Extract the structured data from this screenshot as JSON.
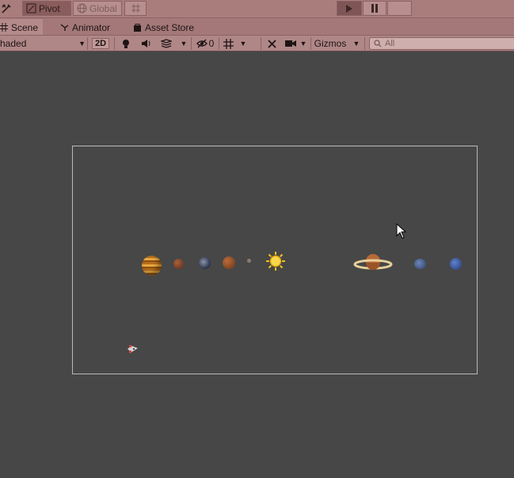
{
  "toolbar": {
    "pivot_label": "Pivot",
    "global_label": "Global"
  },
  "tabs": [
    {
      "label": "Scene",
      "icon": "grid-icon",
      "active": true
    },
    {
      "label": "Animator",
      "icon": "animator-icon",
      "active": false
    },
    {
      "label": "Asset Store",
      "icon": "bag-icon",
      "active": false
    }
  ],
  "scene_toolbar": {
    "shading_mode": "haded",
    "mode_2d_label": "2D",
    "hidden_count": "0",
    "gizmos_label": "Gizmos",
    "search_value": "All"
  },
  "scene": {
    "objects": [
      {
        "name": "jupiter",
        "icon": "planet-jupiter"
      },
      {
        "name": "mars-small",
        "icon": "planet-mars"
      },
      {
        "name": "earth",
        "icon": "planet-earth"
      },
      {
        "name": "venus",
        "icon": "planet-venus"
      },
      {
        "name": "mercury",
        "icon": "planet-mercury"
      },
      {
        "name": "sun",
        "icon": "sun-icon"
      },
      {
        "name": "saturn",
        "icon": "planet-saturn"
      },
      {
        "name": "uranus",
        "icon": "planet-uranus"
      },
      {
        "name": "neptune",
        "icon": "planet-neptune"
      },
      {
        "name": "spaceship",
        "icon": "spaceship-icon"
      }
    ]
  },
  "colors": {
    "play_tint": "#aa7d7d",
    "viewport_bg": "#474747",
    "camera_frame": "#b9b9b9"
  }
}
